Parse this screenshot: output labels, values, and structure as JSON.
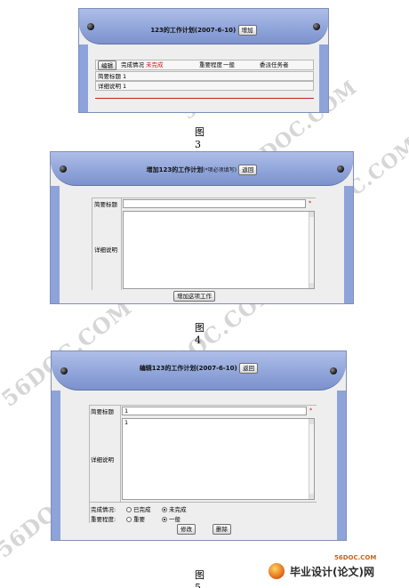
{
  "fig3": {
    "title": "123的工作计划(2007-6-10)",
    "add_button": "增加",
    "edit_button": "编辑",
    "status_label": "完成情况",
    "status_value": "未完成",
    "priority_label": "重要程度",
    "priority_value": "一般",
    "assigner_label": "委派任务者",
    "brief_label": "简要标题",
    "brief_value": "1",
    "detail_label": "详细说明",
    "detail_value": "1",
    "caption": "图 3"
  },
  "fig4": {
    "title": "增加123的工作计划",
    "title_hint": "(*项必须填写)",
    "back_button": "返回",
    "brief_label": "简要标题",
    "detail_label": "详细说明",
    "required_mark": "*",
    "submit_button": "增加这项工作",
    "caption": "图 4"
  },
  "fig5": {
    "title": "编辑123的工作计划(2007-6-10)",
    "back_button": "返回",
    "brief_label": "简要标题",
    "brief_value": "1",
    "detail_label": "详细说明",
    "detail_value": "1",
    "required_mark": "*",
    "status_label": "完成情况:",
    "status_done": "已完成",
    "status_undone": "未完成",
    "priority_label": "重要程度:",
    "priority_high": "重要",
    "priority_normal": "一般",
    "modify_button": "修改",
    "delete_button": "删除",
    "caption": "图 5",
    "status_selected": "未完成",
    "priority_selected": "一般"
  },
  "watermark": {
    "text": "56DOC.COM"
  },
  "footer": {
    "site": "56DOC.COM",
    "name": "毕业设计(论文)网"
  }
}
